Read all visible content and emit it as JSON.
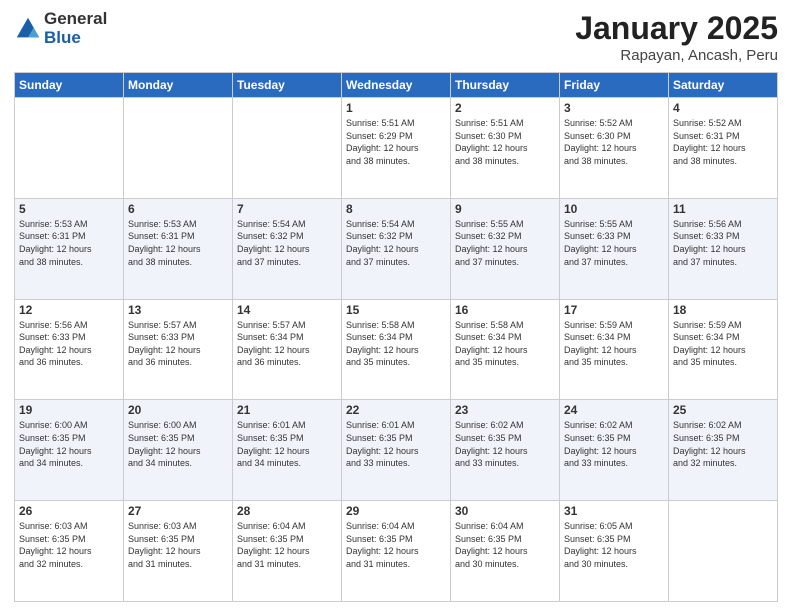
{
  "logo": {
    "general": "General",
    "blue": "Blue"
  },
  "title": {
    "month": "January 2025",
    "location": "Rapayan, Ancash, Peru"
  },
  "headers": [
    "Sunday",
    "Monday",
    "Tuesday",
    "Wednesday",
    "Thursday",
    "Friday",
    "Saturday"
  ],
  "weeks": [
    [
      {
        "day": "",
        "info": ""
      },
      {
        "day": "",
        "info": ""
      },
      {
        "day": "",
        "info": ""
      },
      {
        "day": "1",
        "info": "Sunrise: 5:51 AM\nSunset: 6:29 PM\nDaylight: 12 hours\nand 38 minutes."
      },
      {
        "day": "2",
        "info": "Sunrise: 5:51 AM\nSunset: 6:30 PM\nDaylight: 12 hours\nand 38 minutes."
      },
      {
        "day": "3",
        "info": "Sunrise: 5:52 AM\nSunset: 6:30 PM\nDaylight: 12 hours\nand 38 minutes."
      },
      {
        "day": "4",
        "info": "Sunrise: 5:52 AM\nSunset: 6:31 PM\nDaylight: 12 hours\nand 38 minutes."
      }
    ],
    [
      {
        "day": "5",
        "info": "Sunrise: 5:53 AM\nSunset: 6:31 PM\nDaylight: 12 hours\nand 38 minutes."
      },
      {
        "day": "6",
        "info": "Sunrise: 5:53 AM\nSunset: 6:31 PM\nDaylight: 12 hours\nand 38 minutes."
      },
      {
        "day": "7",
        "info": "Sunrise: 5:54 AM\nSunset: 6:32 PM\nDaylight: 12 hours\nand 37 minutes."
      },
      {
        "day": "8",
        "info": "Sunrise: 5:54 AM\nSunset: 6:32 PM\nDaylight: 12 hours\nand 37 minutes."
      },
      {
        "day": "9",
        "info": "Sunrise: 5:55 AM\nSunset: 6:32 PM\nDaylight: 12 hours\nand 37 minutes."
      },
      {
        "day": "10",
        "info": "Sunrise: 5:55 AM\nSunset: 6:33 PM\nDaylight: 12 hours\nand 37 minutes."
      },
      {
        "day": "11",
        "info": "Sunrise: 5:56 AM\nSunset: 6:33 PM\nDaylight: 12 hours\nand 37 minutes."
      }
    ],
    [
      {
        "day": "12",
        "info": "Sunrise: 5:56 AM\nSunset: 6:33 PM\nDaylight: 12 hours\nand 36 minutes."
      },
      {
        "day": "13",
        "info": "Sunrise: 5:57 AM\nSunset: 6:33 PM\nDaylight: 12 hours\nand 36 minutes."
      },
      {
        "day": "14",
        "info": "Sunrise: 5:57 AM\nSunset: 6:34 PM\nDaylight: 12 hours\nand 36 minutes."
      },
      {
        "day": "15",
        "info": "Sunrise: 5:58 AM\nSunset: 6:34 PM\nDaylight: 12 hours\nand 35 minutes."
      },
      {
        "day": "16",
        "info": "Sunrise: 5:58 AM\nSunset: 6:34 PM\nDaylight: 12 hours\nand 35 minutes."
      },
      {
        "day": "17",
        "info": "Sunrise: 5:59 AM\nSunset: 6:34 PM\nDaylight: 12 hours\nand 35 minutes."
      },
      {
        "day": "18",
        "info": "Sunrise: 5:59 AM\nSunset: 6:34 PM\nDaylight: 12 hours\nand 35 minutes."
      }
    ],
    [
      {
        "day": "19",
        "info": "Sunrise: 6:00 AM\nSunset: 6:35 PM\nDaylight: 12 hours\nand 34 minutes."
      },
      {
        "day": "20",
        "info": "Sunrise: 6:00 AM\nSunset: 6:35 PM\nDaylight: 12 hours\nand 34 minutes."
      },
      {
        "day": "21",
        "info": "Sunrise: 6:01 AM\nSunset: 6:35 PM\nDaylight: 12 hours\nand 34 minutes."
      },
      {
        "day": "22",
        "info": "Sunrise: 6:01 AM\nSunset: 6:35 PM\nDaylight: 12 hours\nand 33 minutes."
      },
      {
        "day": "23",
        "info": "Sunrise: 6:02 AM\nSunset: 6:35 PM\nDaylight: 12 hours\nand 33 minutes."
      },
      {
        "day": "24",
        "info": "Sunrise: 6:02 AM\nSunset: 6:35 PM\nDaylight: 12 hours\nand 33 minutes."
      },
      {
        "day": "25",
        "info": "Sunrise: 6:02 AM\nSunset: 6:35 PM\nDaylight: 12 hours\nand 32 minutes."
      }
    ],
    [
      {
        "day": "26",
        "info": "Sunrise: 6:03 AM\nSunset: 6:35 PM\nDaylight: 12 hours\nand 32 minutes."
      },
      {
        "day": "27",
        "info": "Sunrise: 6:03 AM\nSunset: 6:35 PM\nDaylight: 12 hours\nand 31 minutes."
      },
      {
        "day": "28",
        "info": "Sunrise: 6:04 AM\nSunset: 6:35 PM\nDaylight: 12 hours\nand 31 minutes."
      },
      {
        "day": "29",
        "info": "Sunrise: 6:04 AM\nSunset: 6:35 PM\nDaylight: 12 hours\nand 31 minutes."
      },
      {
        "day": "30",
        "info": "Sunrise: 6:04 AM\nSunset: 6:35 PM\nDaylight: 12 hours\nand 30 minutes."
      },
      {
        "day": "31",
        "info": "Sunrise: 6:05 AM\nSunset: 6:35 PM\nDaylight: 12 hours\nand 30 minutes."
      },
      {
        "day": "",
        "info": ""
      }
    ]
  ]
}
